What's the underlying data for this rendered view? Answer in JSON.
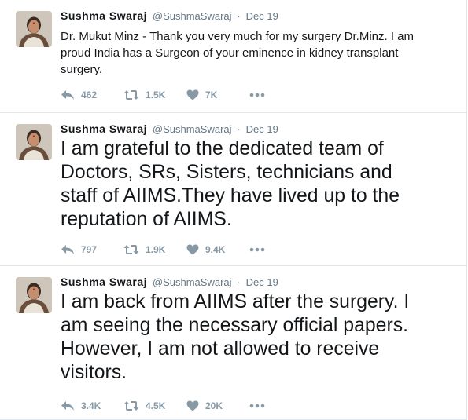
{
  "tweets": [
    {
      "name": "Sushma Swaraj",
      "handle": "@SushmaSwaraj",
      "separator": "·",
      "time": "Dec 19",
      "text_lines": [
        "Dr. Mukut Minz - Thank you very much for my surgery Dr.Minz. I am",
        "proud India has a Surgeon of your eminence in kidney transplant",
        "surgery."
      ],
      "replies": "462",
      "retweets": "1.5K",
      "likes": "7K",
      "reply_icon": "reply-icon",
      "retweet_icon": "retweet-icon",
      "like_icon": "heart-icon",
      "more_icon": "more-icon"
    },
    {
      "name": "Sushma Swaraj",
      "handle": "@SushmaSwaraj",
      "separator": "·",
      "time": "Dec 19",
      "text_lines": [
        "I am grateful to the dedicated team of",
        "Doctors, SRs, Sisters, technicians and",
        "staff of AIIMS.They have lived up to the",
        "reputation of AIIMS."
      ],
      "replies": "797",
      "retweets": "1.9K",
      "likes": "9.4K",
      "reply_icon": "reply-icon",
      "retweet_icon": "retweet-icon",
      "like_icon": "heart-icon",
      "more_icon": "more-icon"
    },
    {
      "name": "Sushma Swaraj",
      "handle": "@SushmaSwaraj",
      "separator": "·",
      "time": "Dec 19",
      "text_lines": [
        "I am back from AIIMS after the surgery. I",
        "am seeing the necessary official papers.",
        "However, I am not allowed to receive",
        "visitors."
      ],
      "replies": "3.4K",
      "retweets": "4.5K",
      "likes": "20K",
      "reply_icon": "reply-icon",
      "retweet_icon": "retweet-icon",
      "like_icon": "heart-icon",
      "more_icon": "more-icon"
    }
  ],
  "colors": {
    "text": "#14171a",
    "meta": "#657786",
    "action": "#8899a6",
    "border": "#e1e8ed"
  }
}
